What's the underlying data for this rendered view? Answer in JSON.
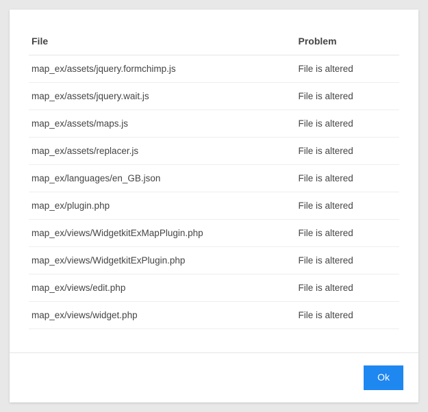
{
  "table": {
    "headers": {
      "file": "File",
      "problem": "Problem"
    },
    "rows": [
      {
        "file": "map_ex/assets/jquery.formchimp.js",
        "problem": "File is altered"
      },
      {
        "file": "map_ex/assets/jquery.wait.js",
        "problem": "File is altered"
      },
      {
        "file": "map_ex/assets/maps.js",
        "problem": "File is altered"
      },
      {
        "file": "map_ex/assets/replacer.js",
        "problem": "File is altered"
      },
      {
        "file": "map_ex/languages/en_GB.json",
        "problem": "File is altered"
      },
      {
        "file": "map_ex/plugin.php",
        "problem": "File is altered"
      },
      {
        "file": "map_ex/views/WidgetkitExMapPlugin.php",
        "problem": "File is altered"
      },
      {
        "file": "map_ex/views/WidgetkitExPlugin.php",
        "problem": "File is altered"
      },
      {
        "file": "map_ex/views/edit.php",
        "problem": "File is altered"
      },
      {
        "file": "map_ex/views/widget.php",
        "problem": "File is altered"
      }
    ]
  },
  "footer": {
    "ok_label": "Ok"
  }
}
